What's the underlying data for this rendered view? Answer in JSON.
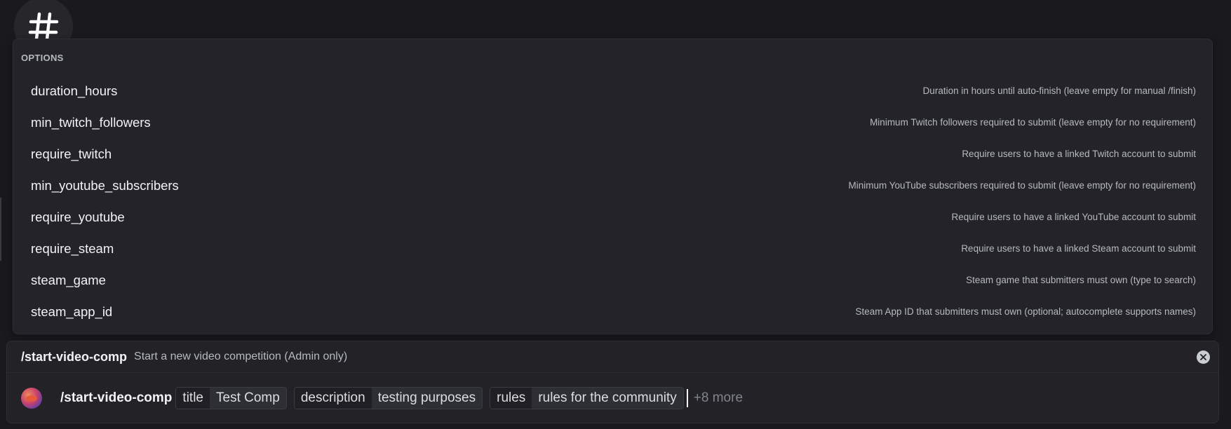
{
  "options_panel": {
    "header": "OPTIONS",
    "items": [
      {
        "name": "duration_hours",
        "description": "Duration in hours until auto-finish (leave empty for manual /finish)"
      },
      {
        "name": "min_twitch_followers",
        "description": "Minimum Twitch followers required to submit (leave empty for no requirement)"
      },
      {
        "name": "require_twitch",
        "description": "Require users to have a linked Twitch account to submit"
      },
      {
        "name": "min_youtube_subscribers",
        "description": "Minimum YouTube subscribers required to submit (leave empty for no requirement)"
      },
      {
        "name": "require_youtube",
        "description": "Require users to have a linked YouTube account to submit"
      },
      {
        "name": "require_steam",
        "description": "Require users to have a linked Steam account to submit"
      },
      {
        "name": "steam_game",
        "description": "Steam game that submitters must own (type to search)"
      },
      {
        "name": "steam_app_id",
        "description": "Steam App ID that submitters must own (optional; autocomplete supports names)"
      }
    ]
  },
  "command_bar": {
    "command": "/start-video-comp",
    "description": "Start a new video competition (Admin only)",
    "input_command": "/start-video-comp",
    "params": [
      {
        "key": "title",
        "value": "Test Comp"
      },
      {
        "key": "description",
        "value": "testing purposes"
      },
      {
        "key": "rules",
        "value": "rules for the community"
      }
    ],
    "more_label": "+8 more"
  },
  "colors": {
    "background": "#1a1a1e",
    "panel": "#232329",
    "text_primary": "#f2f3f5",
    "text_secondary": "#b5bac1"
  },
  "icons": {
    "channel": "hash-icon",
    "close": "close-circle-icon",
    "avatar": "user-avatar"
  }
}
